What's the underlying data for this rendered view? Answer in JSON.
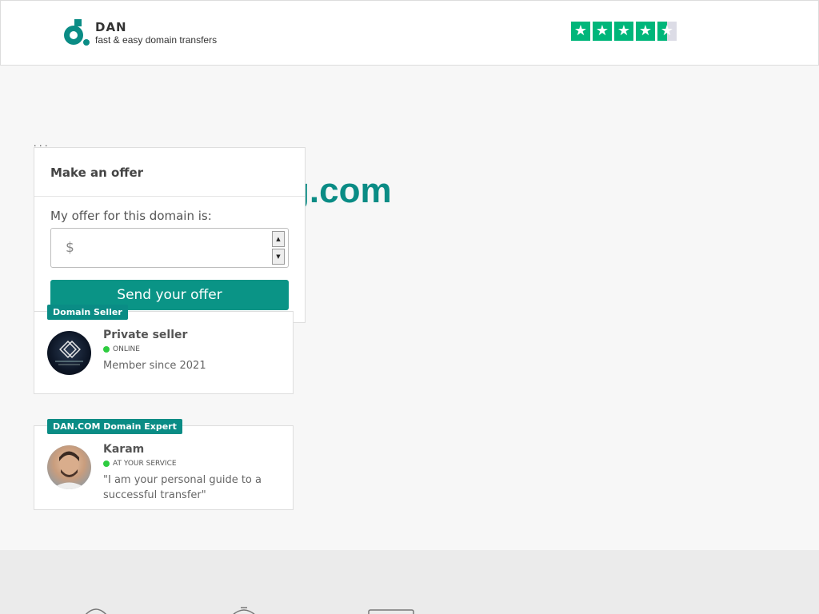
{
  "header": {
    "brand": "DAN",
    "tagline": "fast & easy domain transfers",
    "trust_stars": 4.5,
    "star_color": "#00b67a"
  },
  "main": {
    "domain_name": "g.com"
  },
  "offer": {
    "title": "Make an offer",
    "label": "My offer for this domain is:",
    "currency_symbol": "$",
    "input_value": "",
    "button_label": "Send your offer"
  },
  "seller": {
    "badge": "Domain Seller",
    "name": "Private seller",
    "status": "ONLINE",
    "description": "Member since 2021"
  },
  "expert": {
    "badge": "DAN.COM Domain Expert",
    "name": "Karam",
    "status": "AT YOUR SERVICE",
    "description": "\"I am your personal guide to a successful transfer\""
  },
  "colors": {
    "accent": "#0a8c85",
    "button": "#0a9486",
    "online": "#2ecc40"
  }
}
